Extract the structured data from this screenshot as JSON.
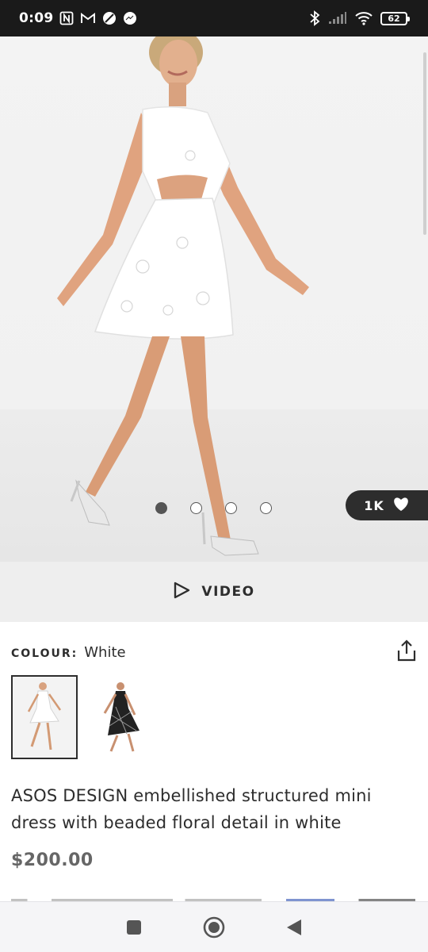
{
  "status_bar": {
    "time": "0:09",
    "battery": "62",
    "left_icons": [
      "nfc-icon",
      "gmail-icon",
      "blocked-icon",
      "messenger-icon"
    ],
    "right_icons": [
      "bluetooth-icon",
      "signal-icon",
      "wifi-icon",
      "battery-icon"
    ]
  },
  "gallery": {
    "image_count": 4,
    "active_index": 0,
    "likes": "1K"
  },
  "video": {
    "label": "VIDEO"
  },
  "colour": {
    "key": "COLOUR:",
    "value": "White"
  },
  "thumbnails": [
    {
      "selected": true
    },
    {
      "selected": false
    }
  ],
  "product": {
    "title": "ASOS DESIGN embellished structured mini dress with beaded floral detail in white",
    "price": "$200.00"
  },
  "colors": {
    "text_dark": "#2d2d2d",
    "price_grey": "#666666",
    "status_bar_bg": "#1a1a1a",
    "video_bar_bg": "#eeeeee"
  }
}
